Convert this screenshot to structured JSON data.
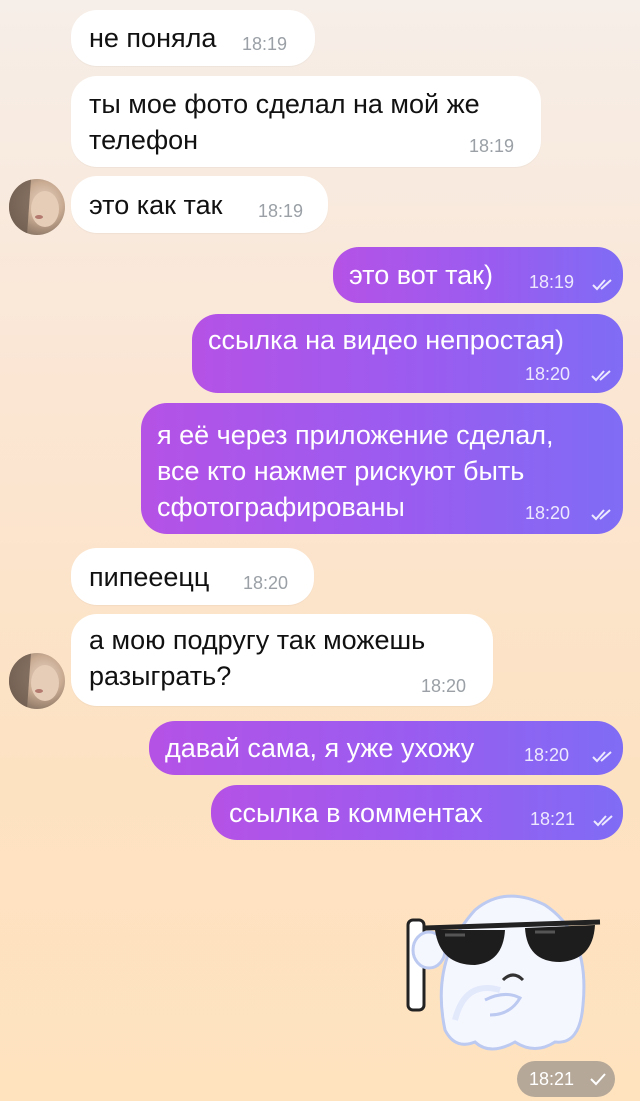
{
  "messages": [
    {
      "text": "не поняла",
      "time": "18:19"
    },
    {
      "text": "ты мое фото сделал на мой же\nтелефон",
      "time": "18:19"
    },
    {
      "text": "это как так",
      "time": "18:19"
    },
    {
      "text": "это вот так)",
      "time": "18:19"
    },
    {
      "text": "ссылка на видео непростая)",
      "time": "18:20"
    },
    {
      "text": "я её через приложение сделал,\nвсе кто нажмет рискуют быть\nсфотографированы",
      "time": "18:20"
    },
    {
      "text": "пипееецц",
      "time": "18:20"
    },
    {
      "text": "а мою подругу так можешь\nразыграть?",
      "time": "18:20"
    },
    {
      "text": "давай сама, я уже ухожу",
      "time": "18:20"
    },
    {
      "text": "ссылка в комментах",
      "time": "18:21"
    }
  ],
  "sticker": {
    "icon": "ghost-sunglasses-sticker",
    "time": "18:21"
  },
  "colors": {
    "incoming": "#ffffff",
    "outgoing_start": "#b552e6",
    "outgoing_end": "#7f6cf5"
  }
}
